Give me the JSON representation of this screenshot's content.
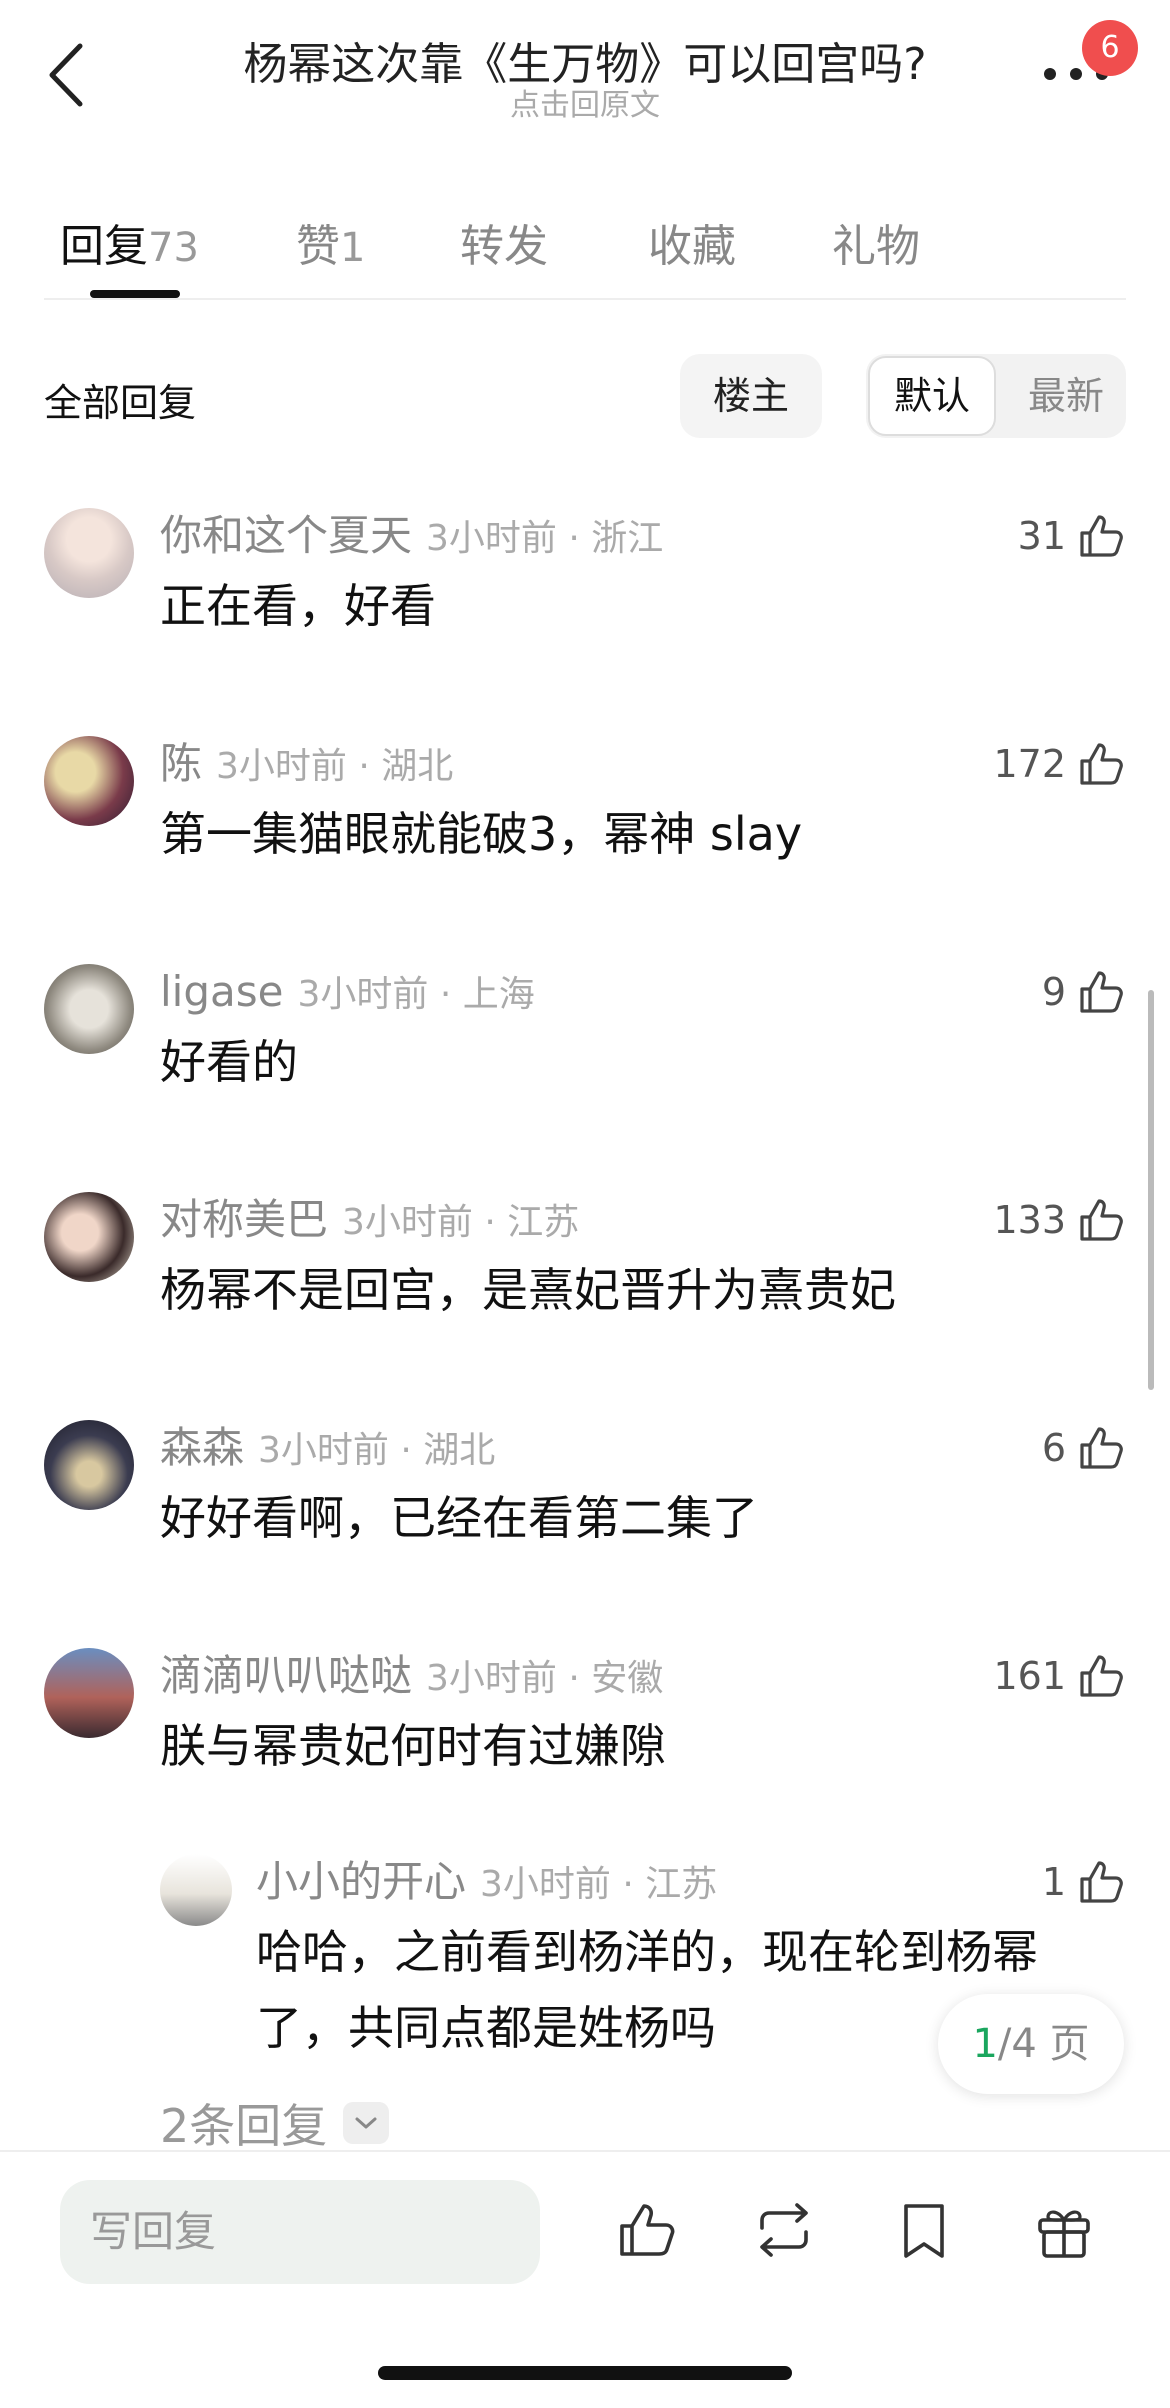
{
  "header": {
    "title": "杨幂这次靠《生万物》可以回宫吗?",
    "subtitle": "点击回原文",
    "badge": "6"
  },
  "tabs": [
    {
      "label": "回复",
      "count": "73",
      "active": true
    },
    {
      "label": "赞",
      "count": "1"
    },
    {
      "label": "转发",
      "count": ""
    },
    {
      "label": "收藏",
      "count": ""
    },
    {
      "label": "礼物",
      "count": ""
    }
  ],
  "filter": {
    "all_replies": "全部回复",
    "op": "楼主",
    "sort_default": "默认",
    "sort_new": "最新"
  },
  "comments": [
    {
      "username": "你和这个夏天",
      "time_loc": "3小时前 · 浙江",
      "text": "正在看，好看",
      "likes": "31"
    },
    {
      "username": "陈",
      "time_loc": "3小时前 · 湖北",
      "text": "第一集猫眼就能破3，幂神 slay",
      "likes": "172"
    },
    {
      "username": "ligase",
      "time_loc": "3小时前 · 上海",
      "text": "好看的",
      "likes": "9"
    },
    {
      "username": "对称美巴",
      "time_loc": "3小时前 · 江苏",
      "text": "杨幂不是回宫，是熹妃晋升为熹贵妃",
      "likes": "133"
    },
    {
      "username": "森森",
      "time_loc": "3小时前 · 湖北",
      "text": "好好看啊，已经在看第二集了",
      "likes": "6"
    },
    {
      "username": "滴滴叭叭哒哒",
      "time_loc": "3小时前 · 安徽",
      "text": "朕与幂贵妃何时有过嫌隙",
      "likes": "161"
    }
  ],
  "sub_reply": {
    "username": "小小的开心",
    "time_loc": "3小时前 · 江苏",
    "text": "哈哈，之前看到杨洋的，现在轮到杨幂了，共同点都是姓杨吗",
    "likes": "1"
  },
  "more_replies": "2条回复",
  "pagination": {
    "current": "1",
    "total": "/4 页"
  },
  "bottom_bar": {
    "reply_placeholder": "写回复",
    "icons": [
      "like-icon",
      "repost-icon",
      "bookmark-icon",
      "gift-icon"
    ]
  }
}
